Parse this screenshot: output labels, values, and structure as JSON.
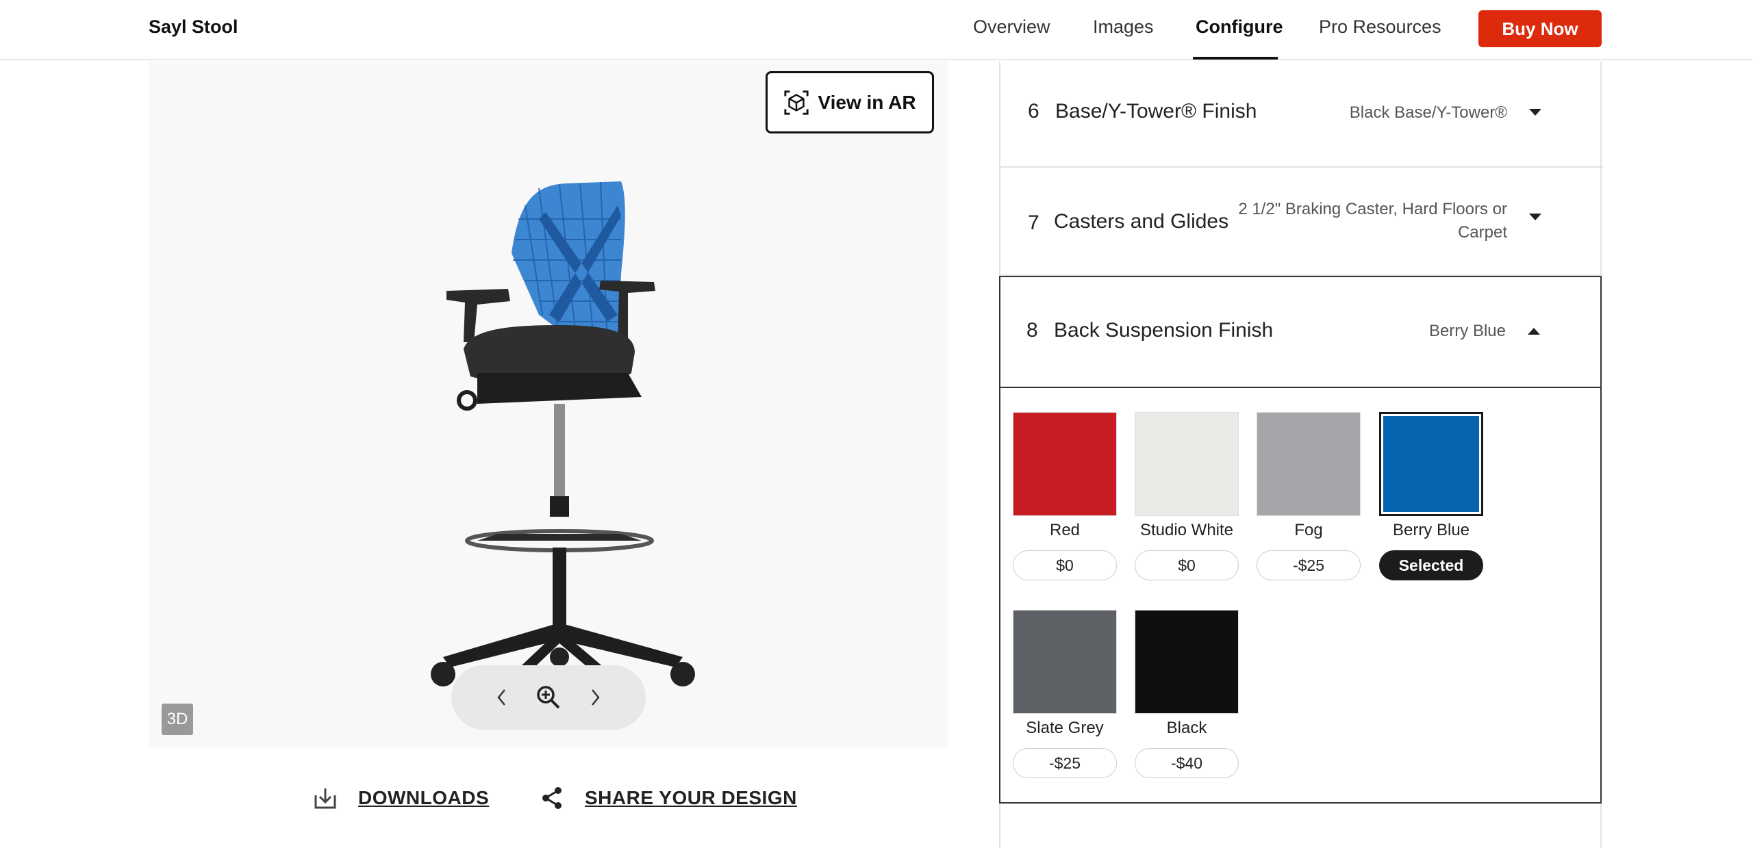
{
  "header": {
    "brand": "Sayl Stool",
    "nav": [
      "Overview",
      "Images",
      "Configure",
      "Pro Resources"
    ],
    "active_tab": "Configure",
    "buy_label": "Buy Now",
    "accent_color": "#dd2a0c"
  },
  "viewer": {
    "ar_label": "View in AR",
    "badge_3d": "3D",
    "prev_icon": "chevron-left-icon",
    "zoom_icon": "zoom-in-icon",
    "next_icon": "chevron-right-icon"
  },
  "links": {
    "downloads": "DOWNLOADS",
    "share": "SHARE YOUR DESIGN"
  },
  "config": {
    "rows": [
      {
        "num": "6",
        "title": "Base/Y-Tower® Finish",
        "value": "Black Base/Y-Tower®"
      },
      {
        "num": "7",
        "title": "Casters and Glides",
        "value_line1": "2 1/2\" Braking Caster, Hard Floors or",
        "value_line2": "Carpet"
      },
      {
        "num": "8",
        "title": "Back Suspension Finish",
        "value": "Berry Blue"
      }
    ],
    "swatches": [
      {
        "name": "Red",
        "price": "$0",
        "color": "#c81c25"
      },
      {
        "name": "Studio White",
        "price": "$0",
        "color": "#eaebe7"
      },
      {
        "name": "Fog",
        "price": "-$25",
        "color": "#a4a6a9"
      },
      {
        "name": "Berry Blue",
        "price": "Selected",
        "color": "#0565b1"
      },
      {
        "name": "Slate Grey",
        "price": "-$25",
        "color": "#5d6064"
      },
      {
        "name": "Black",
        "price": "-$40",
        "color": "#0e0f10"
      }
    ]
  }
}
